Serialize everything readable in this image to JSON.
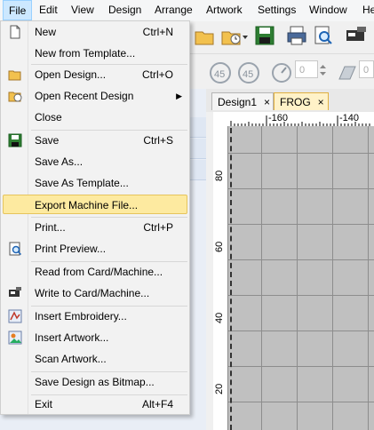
{
  "menubar": {
    "items": [
      "File",
      "Edit",
      "View",
      "Design",
      "Arrange",
      "Artwork",
      "Settings",
      "Window",
      "He"
    ]
  },
  "toolbar": {
    "spin_value_1": "0",
    "spin_value_2": "0"
  },
  "tabs": [
    {
      "label": "Design1",
      "close": "×"
    },
    {
      "label": "FROG",
      "close": "×"
    }
  ],
  "ruler": {
    "top_labels": [
      "-160",
      "-140"
    ],
    "left_labels": [
      "80",
      "60",
      "40",
      "20"
    ]
  },
  "file_menu": {
    "items": [
      {
        "label": "New",
        "shortcut": "Ctrl+N",
        "icon": "new-document-icon"
      },
      {
        "label": "New from Template...",
        "shortcut": "",
        "icon": ""
      },
      {
        "label": "Open Design...",
        "shortcut": "Ctrl+O",
        "icon": "open-folder-icon"
      },
      {
        "label": "Open Recent Design",
        "shortcut": "",
        "icon": "recent-folder-icon",
        "submenu": true
      },
      {
        "label": "Close",
        "shortcut": "",
        "icon": ""
      },
      {
        "label": "Save",
        "shortcut": "Ctrl+S",
        "icon": "save-icon"
      },
      {
        "label": "Save As...",
        "shortcut": "",
        "icon": ""
      },
      {
        "label": "Save As Template...",
        "shortcut": "",
        "icon": ""
      },
      {
        "label": "Export Machine File...",
        "shortcut": "",
        "icon": "",
        "highlighted": true
      },
      {
        "label": "Print...",
        "shortcut": "Ctrl+P",
        "icon": ""
      },
      {
        "label": "Print Preview...",
        "shortcut": "",
        "icon": "print-preview-icon"
      },
      {
        "label": "Read from Card/Machine...",
        "shortcut": "",
        "icon": ""
      },
      {
        "label": "Write to Card/Machine...",
        "shortcut": "",
        "icon": "machine-icon"
      },
      {
        "label": "Insert Embroidery...",
        "shortcut": "",
        "icon": "insert-embroidery-icon"
      },
      {
        "label": "Insert Artwork...",
        "shortcut": "",
        "icon": "insert-artwork-icon"
      },
      {
        "label": "Scan Artwork...",
        "shortcut": "",
        "icon": ""
      },
      {
        "label": "Save Design as Bitmap...",
        "shortcut": "",
        "icon": ""
      },
      {
        "label": "Exit",
        "shortcut": "Alt+F4",
        "icon": ""
      }
    ]
  },
  "colors": {
    "menu_highlight": "#fdeaa0",
    "active_menu": "#cce8ff",
    "active_tab": "#fff2c8"
  }
}
